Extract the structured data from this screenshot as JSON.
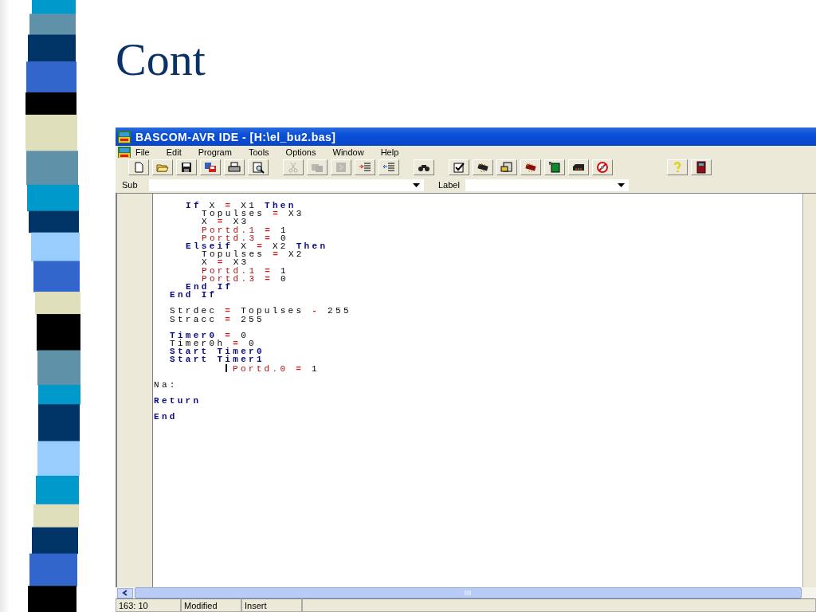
{
  "slide": {
    "title": "Cont"
  },
  "window": {
    "title": "BASCOM-AVR IDE - [H:\\el_bu2.bas]"
  },
  "menu": [
    "File",
    "Edit",
    "Program",
    "Tools",
    "Options",
    "Window",
    "Help"
  ],
  "toolbar": {
    "groups": [
      [
        {
          "kind": "new",
          "disabled": false
        },
        {
          "kind": "open",
          "disabled": false
        },
        {
          "kind": "save",
          "disabled": false
        },
        {
          "kind": "saveas",
          "disabled": false
        },
        {
          "kind": "print",
          "disabled": false
        },
        {
          "kind": "preview",
          "disabled": false
        }
      ],
      [
        {
          "kind": "cut",
          "disabled": true
        },
        {
          "kind": "copy",
          "disabled": true
        },
        {
          "kind": "paste",
          "disabled": true
        },
        {
          "kind": "indent",
          "disabled": false
        },
        {
          "kind": "unindent",
          "disabled": false
        }
      ],
      [
        {
          "kind": "find",
          "disabled": false
        }
      ],
      [
        {
          "kind": "check",
          "disabled": false
        },
        {
          "kind": "chip",
          "disabled": false
        },
        {
          "kind": "simulate",
          "disabled": false
        },
        {
          "kind": "chip2",
          "disabled": false
        },
        {
          "kind": "board",
          "disabled": false
        },
        {
          "kind": "programmer",
          "disabled": false
        },
        {
          "kind": "stop",
          "disabled": false
        }
      ],
      [
        {
          "kind": "help",
          "disabled": false
        },
        {
          "kind": "exit",
          "disabled": false
        }
      ]
    ]
  },
  "combos": [
    {
      "label": "Sub"
    },
    {
      "label": "Label"
    }
  ],
  "code": [
    {
      "kind": "code",
      "tokens": [
        {
          "kind": "keyword",
          "text": "If"
        },
        {
          "kind": "plain",
          "text": "X"
        },
        {
          "kind": "op",
          "text": "="
        },
        {
          "kind": "plain",
          "text": "X1"
        },
        {
          "kind": "keyword",
          "text": "Then"
        }
      ],
      "children": [
        {
          "kind": "code",
          "tokens": [
            {
              "kind": "plain",
              "text": "Topulses"
            },
            {
              "kind": "op",
              "text": "="
            },
            {
              "kind": "plain",
              "text": "X3"
            }
          ]
        },
        {
          "kind": "code",
          "tokens": [
            {
              "kind": "plain",
              "text": "X"
            },
            {
              "kind": "op",
              "text": "="
            },
            {
              "kind": "plain",
              "text": "X3"
            }
          ]
        },
        {
          "kind": "code",
          "tokens": [
            {
              "kind": "port",
              "text": "Portd.1"
            },
            {
              "kind": "op",
              "text": "="
            },
            {
              "kind": "plain",
              "text": "1"
            }
          ]
        },
        {
          "kind": "code",
          "tokens": [
            {
              "kind": "port",
              "text": "Portd.3"
            },
            {
              "kind": "op",
              "text": "="
            },
            {
              "kind": "plain",
              "text": "0"
            }
          ]
        }
      ]
    },
    {
      "kind": "code",
      "tokens": [
        {
          "kind": "keyword",
          "text": "Elseif"
        },
        {
          "kind": "plain",
          "text": "X"
        },
        {
          "kind": "op",
          "text": "="
        },
        {
          "kind": "plain",
          "text": "X2"
        },
        {
          "kind": "keyword",
          "text": "Then"
        }
      ],
      "children": [
        {
          "kind": "code",
          "tokens": [
            {
              "kind": "plain",
              "text": "Topulses"
            },
            {
              "kind": "op",
              "text": "="
            },
            {
              "kind": "plain",
              "text": "X2"
            }
          ]
        },
        {
          "kind": "code",
          "tokens": [
            {
              "kind": "plain",
              "text": "X"
            },
            {
              "kind": "op",
              "text": "="
            },
            {
              "kind": "plain",
              "text": "X3"
            }
          ]
        },
        {
          "kind": "code",
          "tokens": [
            {
              "kind": "port",
              "text": "Portd.1"
            },
            {
              "kind": "op",
              "text": "="
            },
            {
              "kind": "plain",
              "text": "1"
            }
          ]
        },
        {
          "kind": "code",
          "tokens": [
            {
              "kind": "port",
              "text": "Portd.3"
            },
            {
              "kind": "op",
              "text": "="
            },
            {
              "kind": "plain",
              "text": "0"
            }
          ]
        }
      ]
    },
    {
      "kind": "code",
      "tokens": [
        {
          "kind": "keyword",
          "text": "End"
        },
        {
          "kind": "keyword",
          "text": "If"
        }
      ]
    }
  ],
  "code_outer": [
    {
      "kind": "code",
      "tokens": [
        {
          "kind": "keyword",
          "text": "End"
        },
        {
          "kind": "keyword",
          "text": "If"
        }
      ]
    },
    {
      "kind": "blank"
    },
    {
      "kind": "code",
      "tokens": [
        {
          "kind": "plain",
          "text": "Strdec"
        },
        {
          "kind": "op",
          "text": "="
        },
        {
          "kind": "plain",
          "text": "Topulses"
        },
        {
          "kind": "op",
          "text": "-"
        },
        {
          "kind": "plain",
          "text": "255"
        }
      ]
    },
    {
      "kind": "code",
      "tokens": [
        {
          "kind": "plain",
          "text": "Stracc"
        },
        {
          "kind": "op",
          "text": "="
        },
        {
          "kind": "plain",
          "text": "255"
        }
      ]
    },
    {
      "kind": "blank"
    },
    {
      "kind": "code",
      "tokens": [
        {
          "kind": "keyword",
          "text": "Timer0"
        },
        {
          "kind": "op",
          "text": "="
        },
        {
          "kind": "plain",
          "text": "0"
        }
      ]
    },
    {
      "kind": "code",
      "tokens": [
        {
          "kind": "plain",
          "text": "Timer0h"
        },
        {
          "kind": "op",
          "text": "="
        },
        {
          "kind": "plain",
          "text": "0"
        }
      ]
    },
    {
      "kind": "code",
      "tokens": [
        {
          "kind": "keyword",
          "text": "Start"
        },
        {
          "kind": "keyword",
          "text": "Timer0"
        }
      ]
    },
    {
      "kind": "code",
      "tokens": [
        {
          "kind": "keyword",
          "text": "Start"
        },
        {
          "kind": "keyword",
          "text": "Timer1"
        }
      ]
    },
    {
      "kind": "code",
      "tokens": [
        {
          "kind": "caret"
        },
        {
          "kind": "port",
          "text": "Portd.0"
        },
        {
          "kind": "op",
          "text": "="
        },
        {
          "kind": "plain",
          "text": "1"
        }
      ]
    }
  ],
  "code_top": [
    {
      "kind": "blank"
    },
    {
      "kind": "code",
      "tokens": [
        {
          "kind": "plain",
          "text": "Na:"
        }
      ]
    },
    {
      "kind": "blank"
    },
    {
      "kind": "code",
      "tokens": [
        {
          "kind": "keyword",
          "text": "Return"
        }
      ]
    },
    {
      "kind": "blank"
    },
    {
      "kind": "code",
      "tokens": [
        {
          "kind": "keyword",
          "text": "End"
        }
      ]
    }
  ],
  "status_bar": [
    "163: 10",
    "Modified",
    "Insert"
  ]
}
